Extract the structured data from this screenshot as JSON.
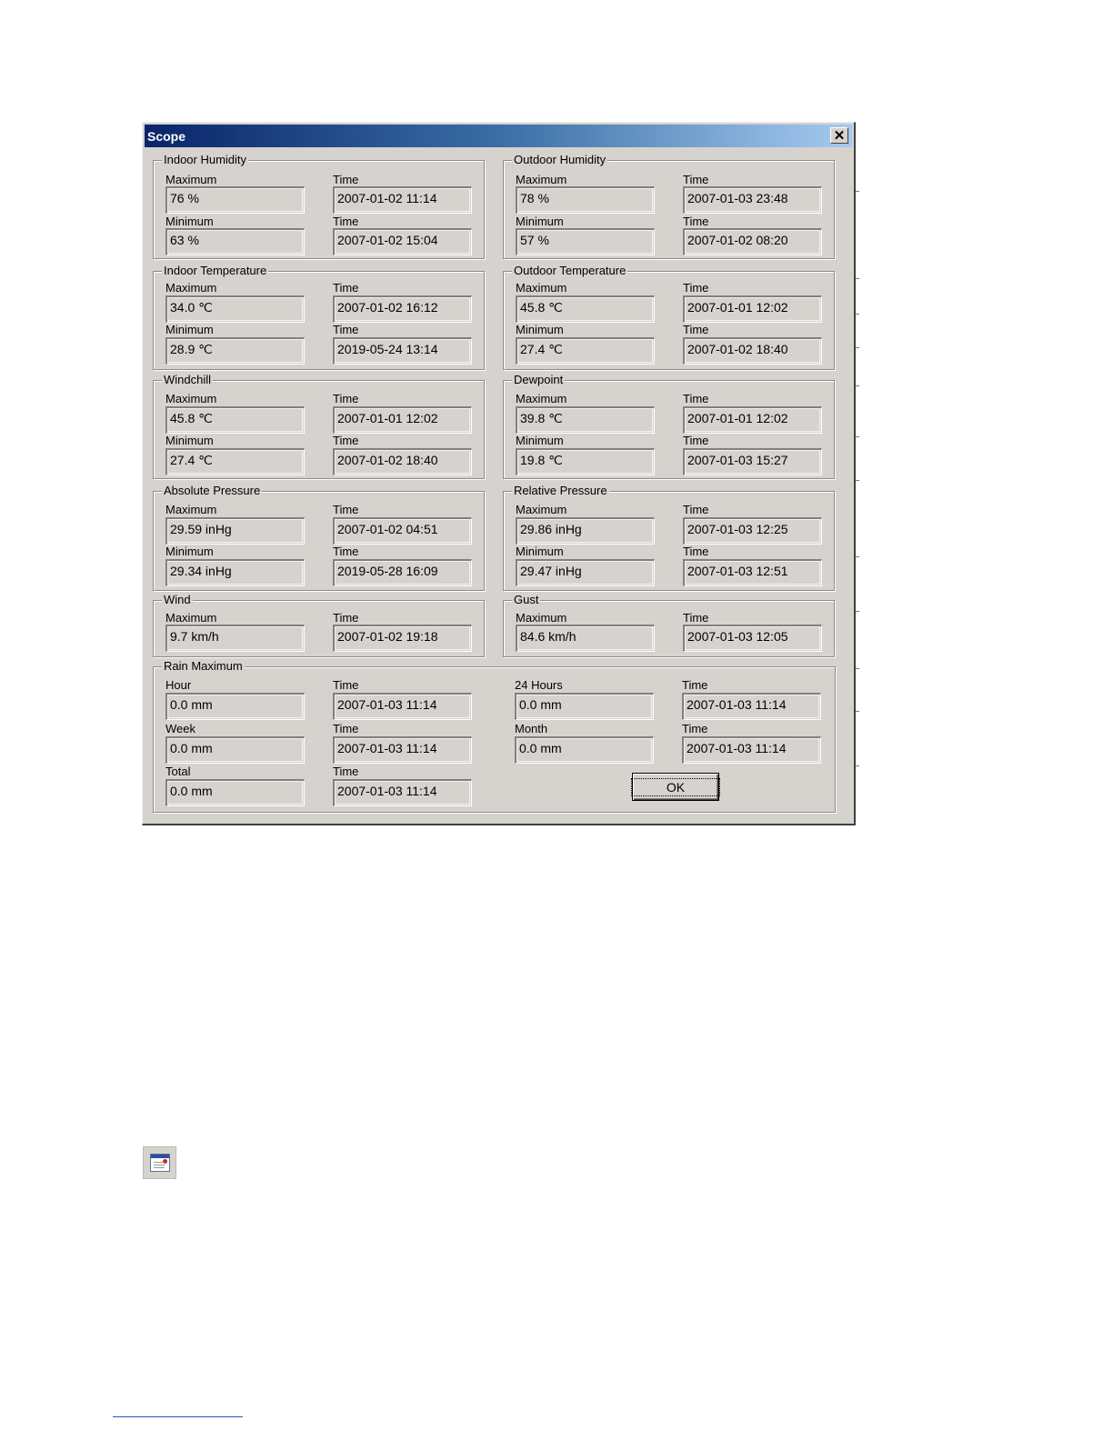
{
  "window": {
    "title": "Scope",
    "close_glyph": "✕",
    "close_icon": "close-icon"
  },
  "groups": {
    "indoor_humidity": {
      "legend": "Indoor Humidity",
      "max_label": "Maximum",
      "min_label": "Minimum",
      "time_label": "Time",
      "max_value": "76 %",
      "max_time": "2007-01-02 11:14",
      "min_value": "63 %",
      "min_time": "2007-01-02 15:04"
    },
    "outdoor_humidity": {
      "legend": "Outdoor Humidity",
      "max_label": "Maximum",
      "min_label": "Minimum",
      "time_label": "Time",
      "max_value": "78 %",
      "max_time": "2007-01-03 23:48",
      "min_value": "57 %",
      "min_time": "2007-01-02 08:20"
    },
    "indoor_temperature": {
      "legend": "Indoor Temperature",
      "max_label": "Maximum",
      "min_label": "Minimum",
      "time_label": "Time",
      "max_value": "34.0 ℃",
      "max_time": "2007-01-02 16:12",
      "min_value": "28.9 ℃",
      "min_time": "2019-05-24 13:14"
    },
    "outdoor_temperature": {
      "legend": "Outdoor Temperature",
      "max_label": "Maximum",
      "min_label": "Minimum",
      "time_label": "Time",
      "max_value": "45.8 ℃",
      "max_time": "2007-01-01 12:02",
      "min_value": "27.4 ℃",
      "min_time": "2007-01-02 18:40"
    },
    "windchill": {
      "legend": "Windchill",
      "max_label": "Maximum",
      "min_label": "Minimum",
      "time_label": "Time",
      "max_value": "45.8 ℃",
      "max_time": "2007-01-01 12:02",
      "min_value": "27.4 ℃",
      "min_time": "2007-01-02 18:40"
    },
    "dewpoint": {
      "legend": "Dewpoint",
      "max_label": "Maximum",
      "min_label": "Minimum",
      "time_label": "Time",
      "max_value": "39.8 ℃",
      "max_time": "2007-01-01 12:02",
      "min_value": "19.8 ℃",
      "min_time": "2007-01-03 15:27"
    },
    "absolute_pressure": {
      "legend": "Absolute Pressure",
      "max_label": "Maximum",
      "min_label": "Minimum",
      "time_label": "Time",
      "max_value": "29.59 inHg",
      "max_time": "2007-01-02 04:51",
      "min_value": "29.34 inHg",
      "min_time": "2019-05-28 16:09"
    },
    "relative_pressure": {
      "legend": "Relative Pressure",
      "max_label": "Maximum",
      "min_label": "Minimum",
      "time_label": "Time",
      "max_value": "29.86 inHg",
      "max_time": "2007-01-03 12:25",
      "min_value": "29.47 inHg",
      "min_time": "2007-01-03 12:51"
    },
    "wind": {
      "legend": "Wind",
      "max_label": "Maximum",
      "time_label": "Time",
      "max_value": "9.7 km/h",
      "max_time": "2007-01-02 19:18"
    },
    "gust": {
      "legend": "Gust",
      "max_label": "Maximum",
      "time_label": "Time",
      "max_value": "84.6 km/h",
      "max_time": "2007-01-03 12:05"
    },
    "rain": {
      "legend": "Rain Maximum",
      "time_label": "Time",
      "hour_label": "Hour",
      "hour_value": "0.0 mm",
      "hour_time": "2007-01-03 11:14",
      "day_label": "24 Hours",
      "day_value": "0.0 mm",
      "day_time": "2007-01-03 11:14",
      "week_label": "Week",
      "week_value": "0.0 mm",
      "week_time": "2007-01-03 11:14",
      "month_label": "Month",
      "month_value": "0.0 mm",
      "month_time": "2007-01-03 11:14",
      "total_label": "Total",
      "total_value": "0.0 mm",
      "total_time": "2007-01-03 11:14"
    }
  },
  "ok_button": {
    "label": "OK"
  },
  "desktop": {
    "app_icon": "calendar-window-icon"
  }
}
